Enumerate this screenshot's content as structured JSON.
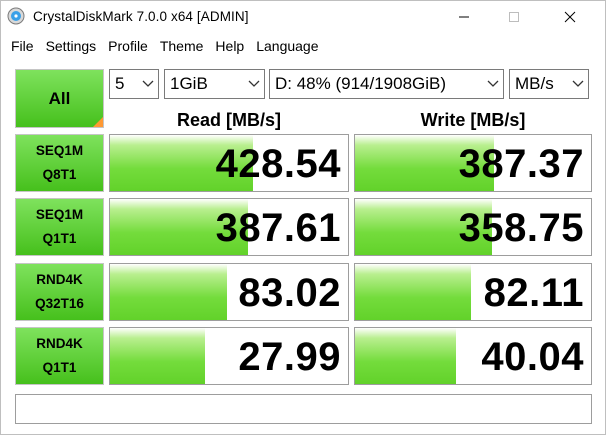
{
  "window": {
    "title": "CrystalDiskMark 7.0.0 x64 [ADMIN]"
  },
  "menu": [
    "File",
    "Settings",
    "Profile",
    "Theme",
    "Help",
    "Language"
  ],
  "controls": {
    "all_label": "All",
    "count": "5",
    "size": "1GiB",
    "drive": "D: 48% (914/1908GiB)",
    "unit": "MB/s"
  },
  "headers": {
    "read": "Read [MB/s]",
    "write": "Write [MB/s]"
  },
  "rows": [
    {
      "line1": "SEQ1M",
      "line2": "Q8T1",
      "read": "428.54",
      "write": "387.37",
      "read_fill": 0.6,
      "write_fill": 0.59
    },
    {
      "line1": "SEQ1M",
      "line2": "Q1T1",
      "read": "387.61",
      "write": "358.75",
      "read_fill": 0.58,
      "write_fill": 0.58
    },
    {
      "line1": "RND4K",
      "line2": "Q32T16",
      "read": "83.02",
      "write": "82.11",
      "read_fill": 0.49,
      "write_fill": 0.49
    },
    {
      "line1": "RND4K",
      "line2": "Q1T1",
      "read": "27.99",
      "write": "40.04",
      "read_fill": 0.4,
      "write_fill": 0.43
    }
  ],
  "status_text": "",
  "colors": {
    "button_green": "#46c01c",
    "bar_green": "#62d22a",
    "accent_orange": "#ff9933"
  }
}
